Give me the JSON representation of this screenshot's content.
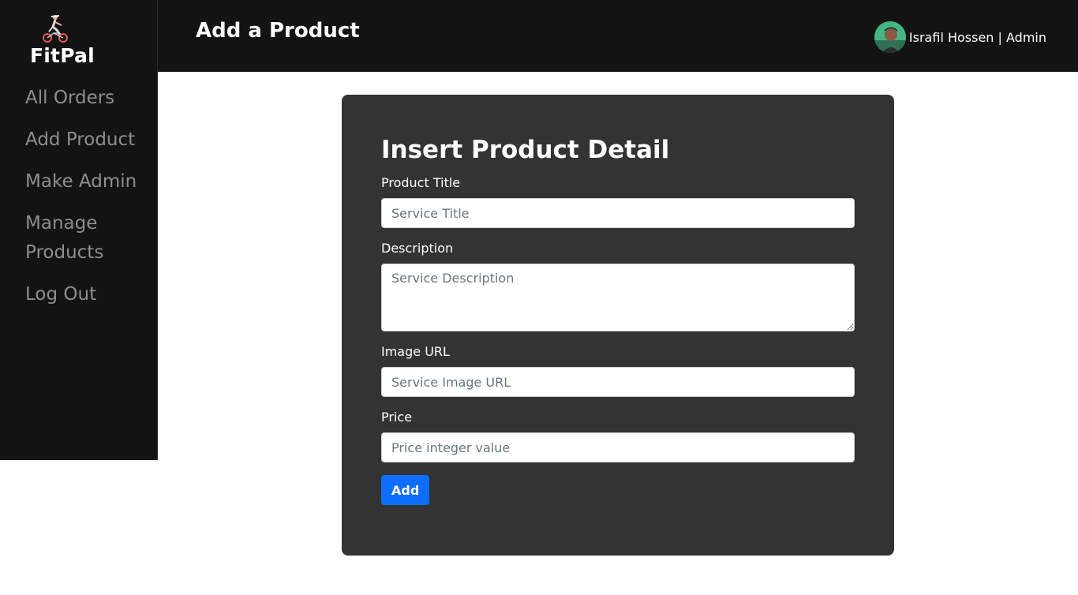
{
  "brand": {
    "name": "FitPal",
    "logo_icon": "cyclist-icon"
  },
  "sidebar": {
    "items": [
      {
        "label": "All Orders"
      },
      {
        "label": "Add Product"
      },
      {
        "label": "Make Admin"
      },
      {
        "label": "Manage Products"
      },
      {
        "label": "Log Out"
      }
    ]
  },
  "header": {
    "title": "Add a Product",
    "user_label": "Israfil Hossen | Admin",
    "avatar_icon": "user-avatar"
  },
  "form": {
    "heading": "Insert Product Detail",
    "title_label": "Product Title",
    "title_placeholder": "Service Title",
    "description_label": "Description",
    "description_placeholder": "Service Description",
    "image_label": "Image URL",
    "image_placeholder": "Service Image URL",
    "price_label": "Price",
    "price_placeholder": "Price integer value",
    "submit_label": "Add"
  },
  "colors": {
    "dark_bg": "#131313",
    "card_bg": "#333333",
    "primary": "#0d6efd",
    "nav_text": "#8e8e8e"
  }
}
